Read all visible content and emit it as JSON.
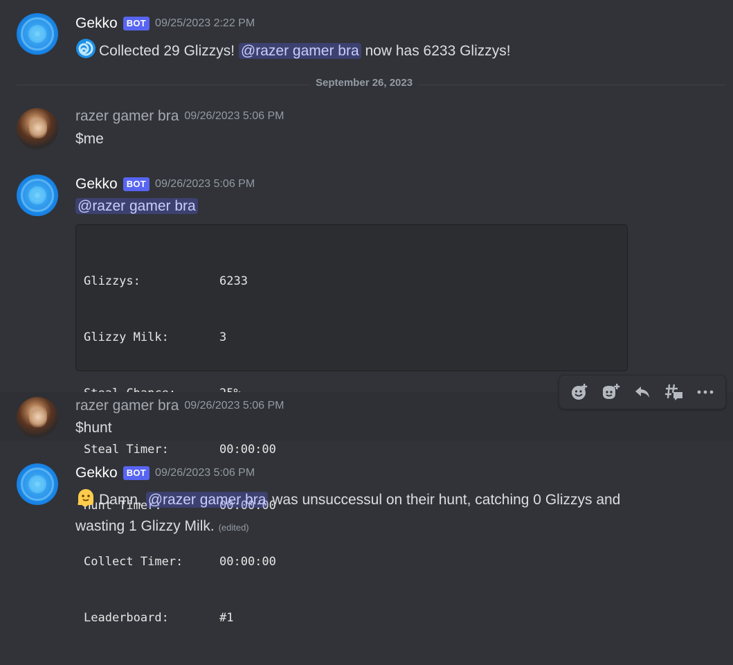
{
  "messages": [
    {
      "author": "Gekko",
      "badge": "BOT",
      "timestamp": "09/25/2023 2:22 PM",
      "text_before": "Collected 29 Glizzys!",
      "mention": "@razer gamer bra",
      "text_after": "now has 6233 Glizzys!",
      "emoji_icon": "swirl-emoji-icon"
    },
    {
      "author": "razer gamer bra",
      "timestamp": "09/26/2023 5:06 PM",
      "text": "$me"
    },
    {
      "author": "Gekko",
      "badge": "BOT",
      "timestamp": "09/26/2023 5:06 PM",
      "mention": "@razer gamer bra",
      "stats": [
        {
          "key": "Glizzys:",
          "value": "6233"
        },
        {
          "key": "Glizzy Milk:",
          "value": "3"
        },
        {
          "key": "Steal Chance:",
          "value": "25%"
        },
        {
          "key": "Steal Timer:",
          "value": "00:00:00"
        },
        {
          "key": "Hunt Timer:",
          "value": "00:00:00"
        },
        {
          "key": "Collect Timer:",
          "value": "00:00:00"
        },
        {
          "key": "Leaderboard:",
          "value": "#1"
        }
      ]
    },
    {
      "author": "razer gamer bra",
      "timestamp": "09/26/2023 5:06 PM",
      "text": "$hunt"
    },
    {
      "author": "Gekko",
      "badge": "BOT",
      "timestamp": "09/26/2023 5:06 PM",
      "text_before": "Damn,",
      "mention": "@razer gamer bra",
      "text_after": "was unsuccessul on their hunt, catching 0 Glizzys and",
      "text_line2": "wasting 1 Glizzy Milk.",
      "edited": "(edited)",
      "emoji_icon": "melting-face-emoji-icon"
    }
  ],
  "date_divider": "September 26, 2023",
  "toolbar": {
    "icons": [
      "add-reaction-icon",
      "super-reaction-icon",
      "reply-icon",
      "create-thread-icon",
      "more-icon"
    ]
  },
  "colors": {
    "background": "#313338",
    "badge": "#5865f2",
    "mention_bg": "rgba(88,101,242,0.30)",
    "mention_text": "#c9cdfb"
  }
}
